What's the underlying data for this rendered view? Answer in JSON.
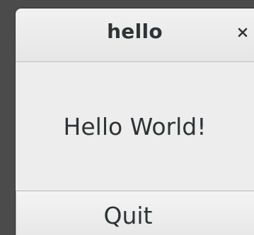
{
  "window": {
    "title": "hello",
    "close_icon": "close-icon"
  },
  "content": {
    "label": "Hello World!"
  },
  "quit_button": {
    "label": "Quit"
  }
}
